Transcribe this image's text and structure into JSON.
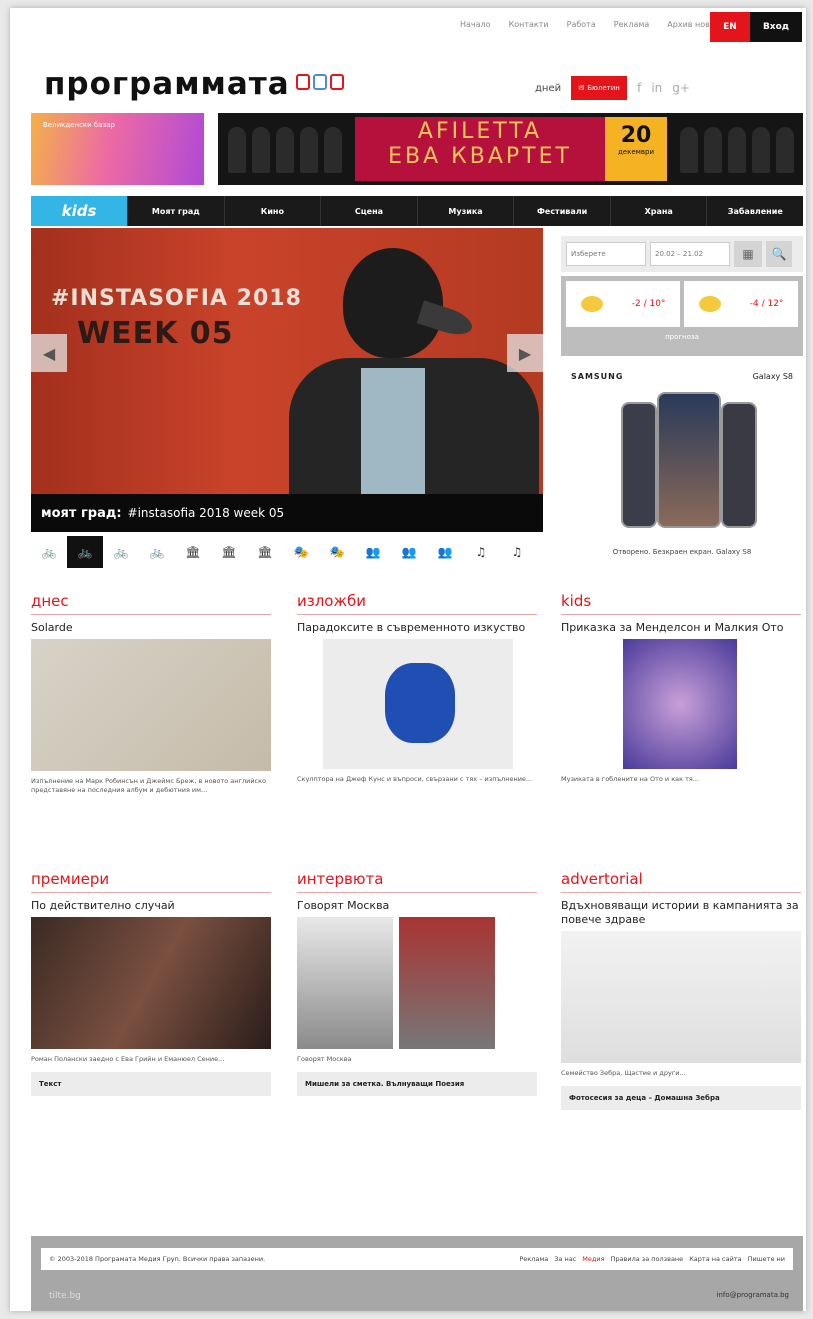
{
  "topbar": {
    "links": [
      "Начало",
      "Контакти",
      "Работа",
      "Реклама",
      "Архив новини"
    ],
    "lang_en": "EN",
    "lang_bg": "Вход"
  },
  "logo": {
    "text": "программата"
  },
  "header": {
    "city": "дней",
    "mail_label": "Бюлетин",
    "social": [
      "f",
      "in",
      "g+"
    ]
  },
  "banners": {
    "left_text": "Великденски базар",
    "title_line1": "AFILETTA",
    "title_line2": "ЕВА КВАРТЕТ",
    "date_day": "20",
    "date_month": "декември"
  },
  "nav": {
    "kids": "kids",
    "items": [
      "Моят град",
      "Кино",
      "Сцена",
      "Музика",
      "Фестивали",
      "Храна",
      "Забавление"
    ]
  },
  "hero": {
    "line1": "#INSTASOFIA 2018",
    "line2": "WEEK 05",
    "caption_bold": "моят град:",
    "caption_text": "#instasofia 2018 week 05",
    "prev": "◀",
    "next": "▶"
  },
  "hero_icons": [
    "🚲",
    "🚲",
    "🚲",
    "🚲",
    "🏛",
    "🏛",
    "🏛",
    "🎭",
    "🎭",
    "👥",
    "👥",
    "👥",
    "♫",
    "♫"
  ],
  "sidebar": {
    "search_select": "Изберете",
    "search_date": "20.02 – 21.02",
    "search_go": "🔍",
    "weather_left": "-2 / 10°",
    "weather_right": "-4 / 12°",
    "weather_label": "прогноза",
    "ad_brand": "SAMSUNG",
    "ad_model": "Galaxy S8",
    "ad_caption": "Отворено. Безкраен екран. Galaxy S8"
  },
  "sections": {
    "dnes": {
      "head": "днес",
      "title": "Solarde",
      "desc": "Изпълнение на Марк Робинсън и Джеймс Бреж, в новото английско представяне на последния албум и дебютния им..."
    },
    "izlozhbi": {
      "head": "изложби",
      "title": "Парадоксите в съвременното изкуство",
      "desc": "Скулптора на Джеф Кунс и въпроси, свързани с тях – изпълнение..."
    },
    "kids": {
      "head": "kids",
      "title": "Приказка за Менделсон и Малкия Ото",
      "desc": "Музиката в гоблените на Ото и как тя..."
    },
    "premieri": {
      "head": "премиери",
      "title": "По действително случай",
      "desc": "Роман Полански заедно с Ева Грийн и Еманюел Сение...",
      "box": "Текст"
    },
    "intervyu": {
      "head": "интервюта",
      "title": "Говорят Москва",
      "caption": "Говорят Москва",
      "box": "Мишели за сметка. Вълнуващи Поезия"
    },
    "advertorial": {
      "head": "advertorial",
      "title": "Вдъхновяващи истории в кампанията за повече здраве",
      "desc": "Семейство Зебра, Щастие и други...",
      "box": "Фотосесия за деца – Домашна Зебра"
    }
  },
  "footer": {
    "copyright": "© 2003-2018 Програмата Медия Груп. Всички права запазени.",
    "links": [
      "Реклама",
      "За нас",
      "Медия",
      "Правила за ползване",
      "Карта на сайта",
      "Пишете ни"
    ],
    "bottom_left": "tilte.bg",
    "bottom_right": "info@programata.bg"
  },
  "colors": {
    "accent": "#e4151a",
    "kids": "#33b6e5",
    "nav": "#1a1a1a"
  }
}
